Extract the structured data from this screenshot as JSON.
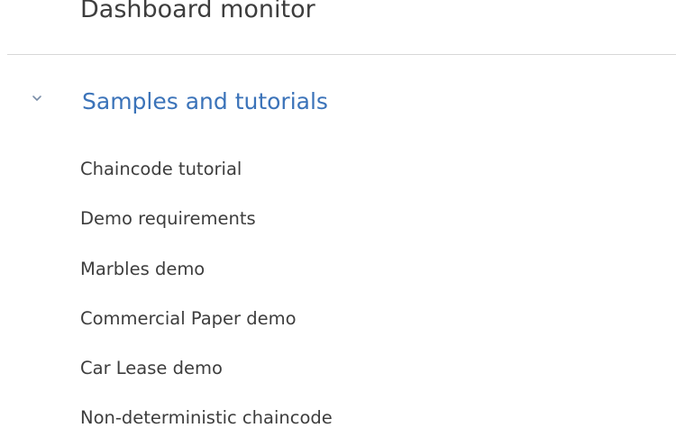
{
  "nav": {
    "previous_item_label": "Dashboard monitor",
    "section": {
      "title": "Samples and tutorials",
      "icon": "chevron-down-icon",
      "expanded": true,
      "items": [
        {
          "label": "Chaincode tutorial"
        },
        {
          "label": "Demo requirements"
        },
        {
          "label": "Marbles demo"
        },
        {
          "label": "Commercial Paper demo"
        },
        {
          "label": "Car Lease demo"
        },
        {
          "label": "Non-deterministic chaincode"
        }
      ]
    }
  },
  "colors": {
    "link_blue": "#3b73b9",
    "text": "#3d3d3d",
    "divider": "#d7d7d7",
    "chevron": "#7a8ea8"
  }
}
